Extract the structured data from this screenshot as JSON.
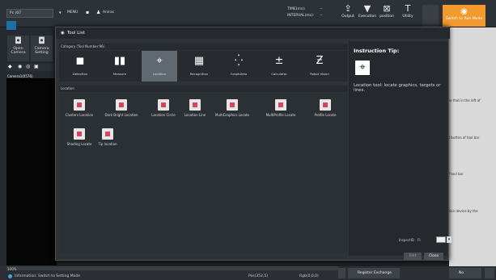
{
  "topbar": {
    "field1": "Pc (07",
    "menu_label": "MENU",
    "user": "Anirac",
    "time_label": "TIME(ms):",
    "time_value": "--",
    "interval_label": "INTERVAL(ms):",
    "interval_value": "--",
    "buttons": [
      "Output",
      "Execution",
      "position",
      "Utility"
    ],
    "switch_label": "Switch to Run Mode"
  },
  "left": {
    "camera_buttons": [
      "Open Camera",
      "Camera Setting"
    ],
    "camera_label": "Camera1(0576)",
    "zoom": "100%"
  },
  "dialog": {
    "title": "Tool List",
    "category_header": "Category (Tool Number:96)",
    "categories": [
      "Detection",
      "Measure",
      "Location",
      "Recognition",
      "GraphArea",
      "Calculator",
      "Robot Vision"
    ],
    "location_header": "Location",
    "tools": [
      "Clusters Location",
      "Dark Bright Location",
      "Location Circle",
      "Location Line",
      "MultiGraphics Locate",
      "MultiProfile Locate",
      "Profile Locate",
      "Shading Locate",
      "Tip location"
    ],
    "tip_title": "Instruction Tip:",
    "tip_text": "Location tool: locate graphics, targets or lines.",
    "inspect_label": "InspectID",
    "inspect_prefix": "FI",
    "edit_label": "Edit",
    "close_label": "Close"
  },
  "right_texts": [
    "ear that in the left of",
    "et button of tool bar",
    "of tool bar",
    "ation device by the"
  ],
  "bottom": {
    "status": "Information: Switch to Setting Mode",
    "pos": "Pos(352,5)",
    "rgb": "Rgb(0,0,0)",
    "register_label": "Register Exchange",
    "inspection_label": "No Inspection"
  }
}
